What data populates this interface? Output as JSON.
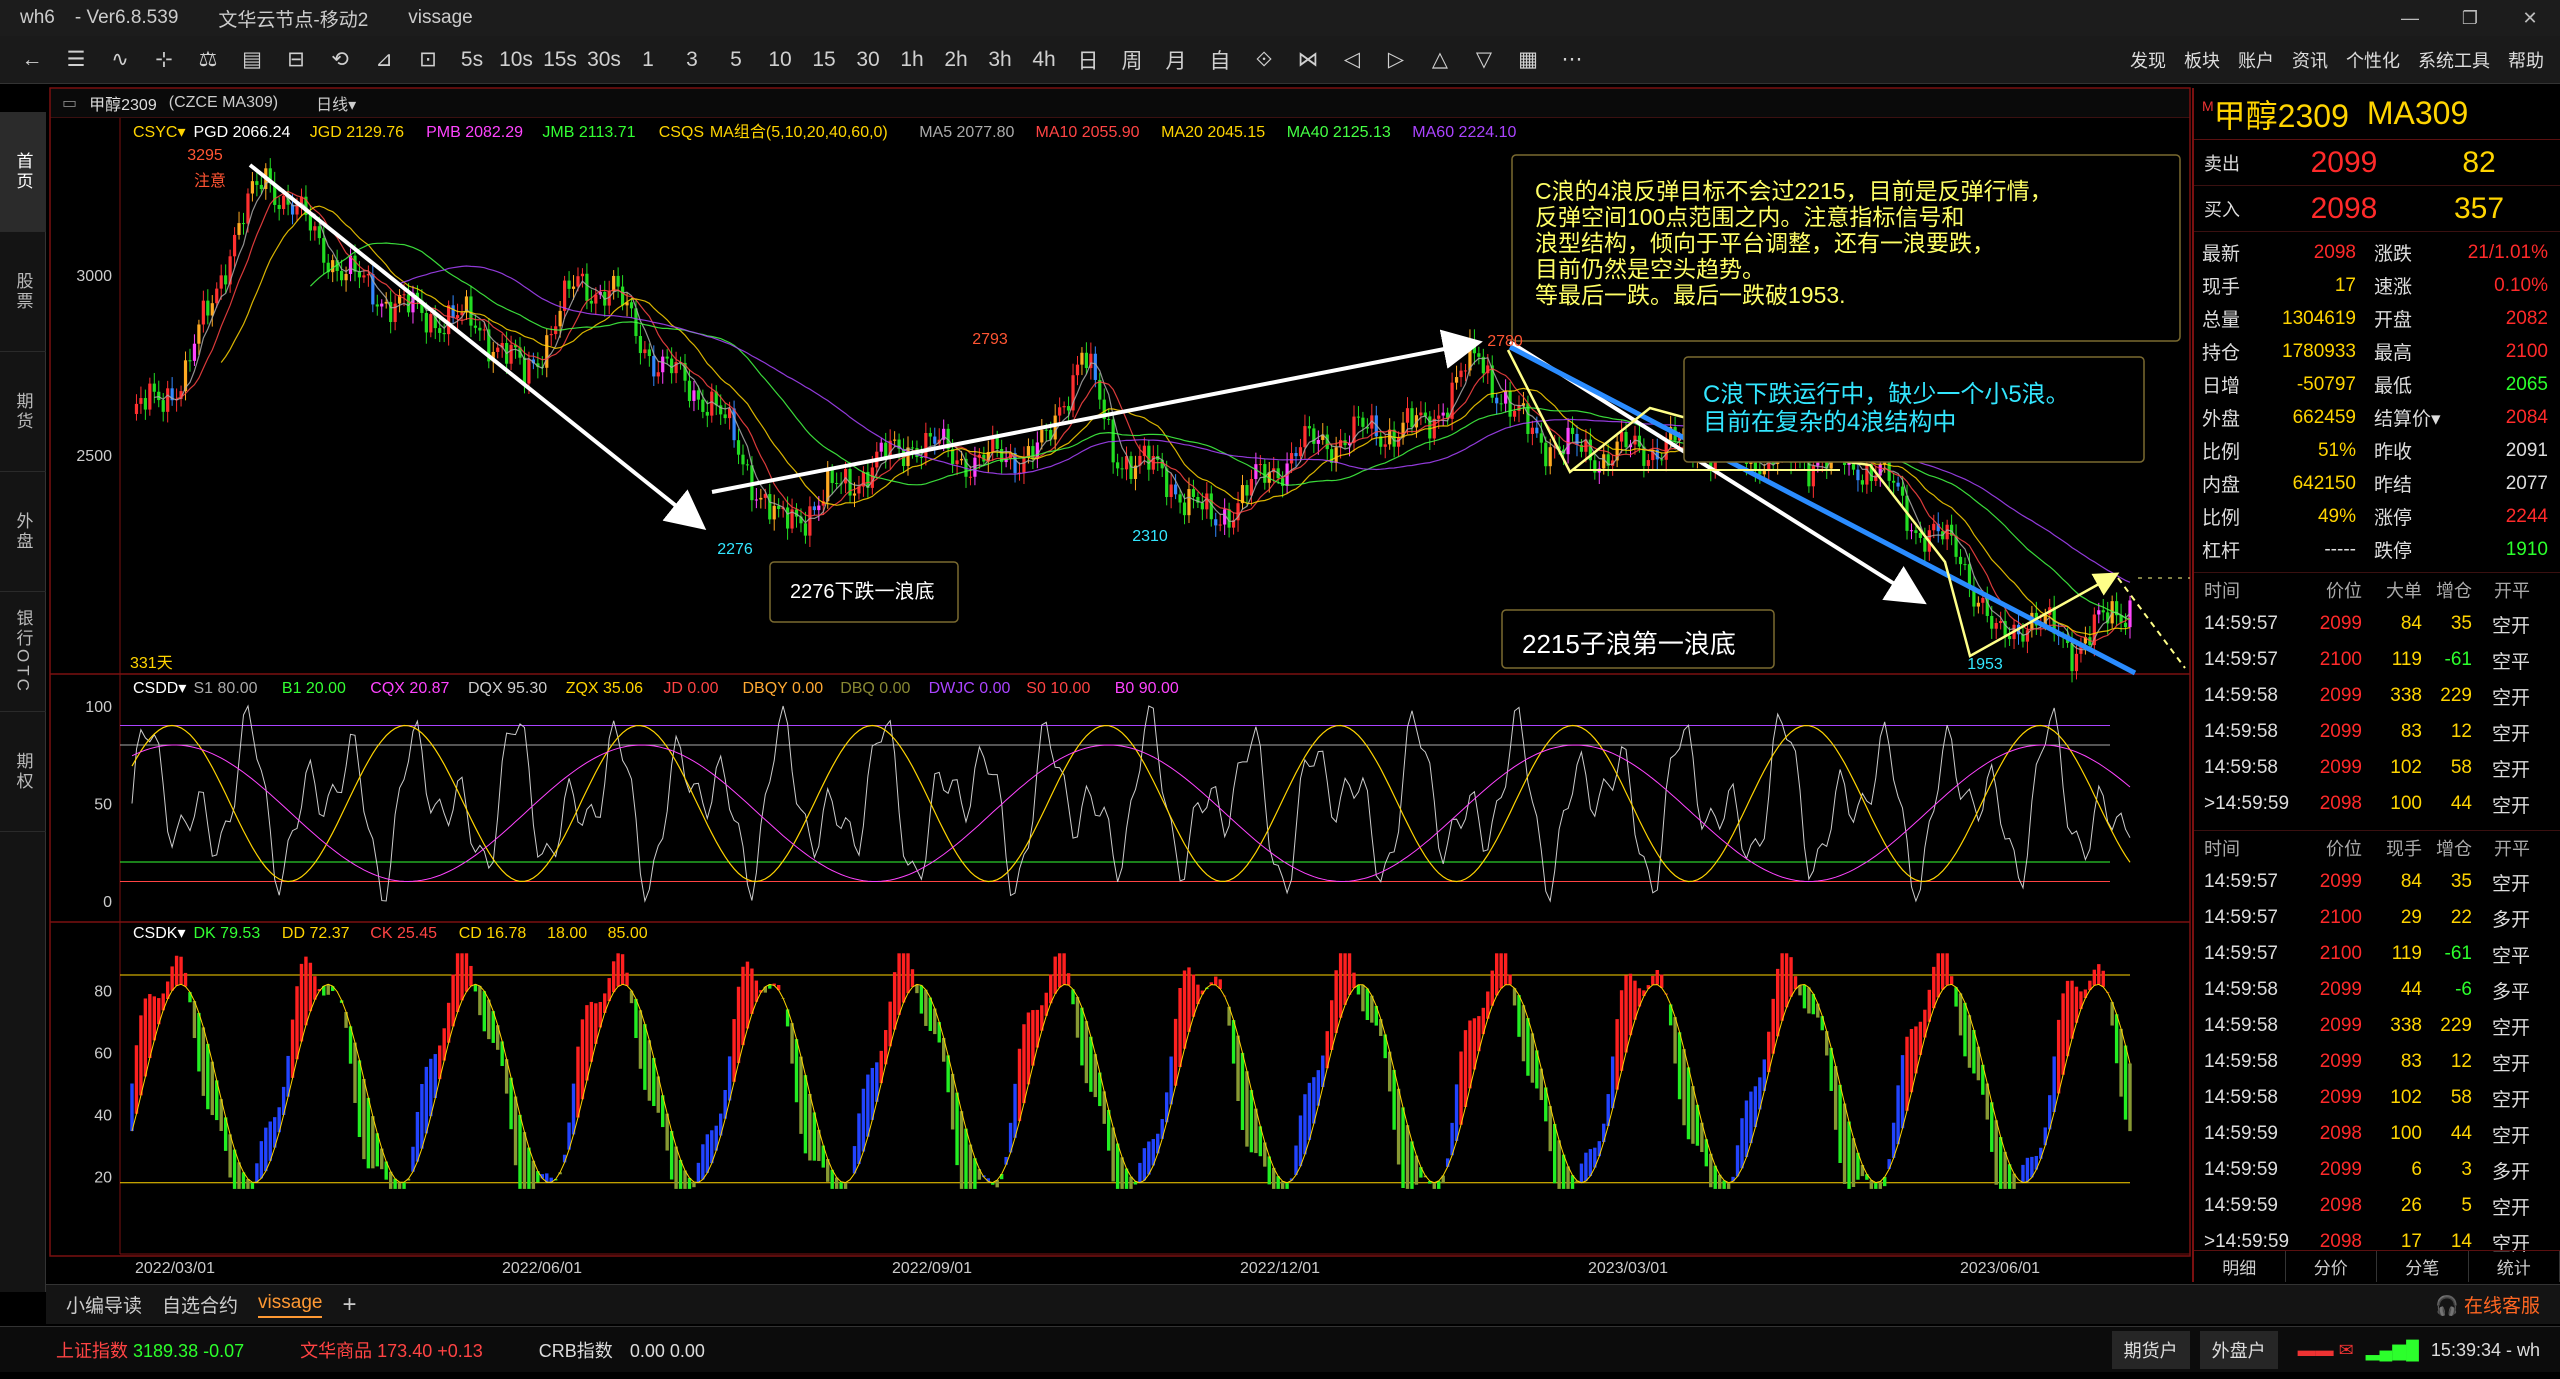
{
  "window": {
    "app": "wh6",
    "version": "Ver6.8.539",
    "server": "文华云节点-移动2",
    "user": "vissage",
    "controls": [
      "—",
      "❐",
      "✕"
    ]
  },
  "toolbar": {
    "tools": [
      "←",
      "☰",
      "∿",
      "⊹",
      "⚖",
      "▤",
      "⊟",
      "⟲",
      "⊿",
      "⊡",
      "5s",
      "10s",
      "15s",
      "30s",
      "1",
      "3",
      "5",
      "10",
      "15",
      "30",
      "1h",
      "2h",
      "3h",
      "4h",
      "日",
      "周",
      "月",
      "自",
      "⟐",
      "⋈",
      "◁",
      "▷",
      "△",
      "▽",
      "▦",
      "⋯"
    ],
    "menu": [
      "发现",
      "板块",
      "账户",
      "资讯",
      "个性化",
      "系统工具",
      "帮助"
    ]
  },
  "sidebar": [
    "首页",
    "股票",
    "期货",
    "外盘",
    "银行OTC",
    "期权"
  ],
  "chart_header": {
    "symbol": "甲醇2309",
    "code": "(CZCE MA309)",
    "period": "日线"
  },
  "main_legend": [
    {
      "t": "CSYC▾",
      "c": "#ffd400"
    },
    {
      "t": "PGD 2066.24",
      "c": "#ffffff"
    },
    {
      "t": "JGD 2129.76",
      "c": "#ffd400"
    },
    {
      "t": "PMB 2082.29",
      "c": "#ff44ff"
    },
    {
      "t": "JMB 2113.71",
      "c": "#33ff33"
    },
    {
      "t": "CSQS",
      "c": "#ffd400"
    },
    {
      "t": "MA组合(5,10,20,40,60,0)",
      "c": "#ffd400"
    },
    {
      "t": "MA5 2077.80",
      "c": "#aaaaaa"
    },
    {
      "t": "MA10 2055.90",
      "c": "#ff4444"
    },
    {
      "t": "MA20 2045.15",
      "c": "#ffd400"
    },
    {
      "t": "MA40 2125.13",
      "c": "#44ff44"
    },
    {
      "t": "MA60 2224.10",
      "c": "#aa44ff"
    }
  ],
  "sub1_legend": [
    {
      "t": "CSDD▾",
      "c": "#ffffff"
    },
    {
      "t": "S1 80.00",
      "c": "#aaaaaa"
    },
    {
      "t": "B1 20.00",
      "c": "#33ff33"
    },
    {
      "t": "CQX 20.87",
      "c": "#ff44ff"
    },
    {
      "t": "DQX 95.30",
      "c": "#cccccc"
    },
    {
      "t": "ZQX 35.06",
      "c": "#ffd400"
    },
    {
      "t": "JD 0.00",
      "c": "#ff4444"
    },
    {
      "t": "DBQY 0.00",
      "c": "#ffaa33"
    },
    {
      "t": "DBQ 0.00",
      "c": "#888833"
    },
    {
      "t": "DWJC 0.00",
      "c": "#aa44ff"
    },
    {
      "t": "S0 10.00",
      "c": "#ff4444"
    },
    {
      "t": "B0 90.00",
      "c": "#ff44ff"
    }
  ],
  "sub2_legend": [
    {
      "t": "CSDK▾",
      "c": "#ffffff"
    },
    {
      "t": "DK 79.53",
      "c": "#33ff33"
    },
    {
      "t": "DD 72.37",
      "c": "#ffd400"
    },
    {
      "t": "CK 25.45",
      "c": "#ff4444"
    },
    {
      "t": "CD 16.78",
      "c": "#ffd400"
    },
    {
      "t": "18.00",
      "c": "#ffd400"
    },
    {
      "t": "85.00",
      "c": "#ffd400"
    }
  ],
  "main_axis": [
    "3000",
    "2500"
  ],
  "sub1_axis": [
    "100",
    "50",
    "0"
  ],
  "sub2_axis": [
    "80",
    "60",
    "40",
    "20"
  ],
  "x_dates": [
    "2022/03/01",
    "2022/06/01",
    "2022/09/01",
    "2022/12/01",
    "2023/03/01",
    "2023/06/01"
  ],
  "price_labels": [
    "3295",
    "注意",
    "2793",
    "2780",
    "2276",
    "2310",
    "1953"
  ],
  "days_label": "331天",
  "annotations": {
    "box1": [
      "C浪的4浪反弹目标不会过2215，目前是反弹行情，",
      "反弹空间100点范围之内。注意指标信号和",
      "浪型结构，倾向于平台调整，还有一浪要跌，",
      "目前仍然是空头趋势。",
      "等最后一跌。最后一跌破1953."
    ],
    "box2": [
      "C浪下跌运行中，缺少一个小5浪。",
      "目前在复杂的4浪结构中"
    ],
    "box3": "2276下跌一浪底",
    "box4": "2215子浪第一浪底"
  },
  "quote": {
    "symbol": "甲醇2309",
    "code": "MA309",
    "flag": "M",
    "ask": {
      "label": "卖出",
      "price": "2099",
      "vol": "82"
    },
    "bid": {
      "label": "买入",
      "price": "2098",
      "vol": "357"
    },
    "stats": [
      [
        "最新",
        "2098",
        "pos",
        "涨跌",
        "21/1.01%",
        "pos"
      ],
      [
        "现手",
        "17",
        "yel",
        "速涨",
        "0.10%",
        "pos"
      ],
      [
        "总量",
        "1304619",
        "yel",
        "开盘",
        "2082",
        "pos"
      ],
      [
        "持仓",
        "1780933",
        "yel",
        "最高",
        "2100",
        "pos"
      ],
      [
        "日增",
        "-50797",
        "yel",
        "最低",
        "2065",
        "neg"
      ],
      [
        "外盘",
        "662459",
        "yel",
        "结算价▾",
        "2084",
        "pos"
      ],
      [
        "比例",
        "51%",
        "yel",
        "昨收",
        "2091",
        ""
      ],
      [
        "内盘",
        "642150",
        "yel",
        "昨结",
        "2077",
        ""
      ],
      [
        "比例",
        "49%",
        "yel",
        "涨停",
        "2244",
        "pos"
      ],
      [
        "杠杆",
        "-----",
        "",
        "跌停",
        "1910",
        "neg"
      ]
    ]
  },
  "ticks1": {
    "head": [
      "时间",
      "价位",
      "大单",
      "增仓",
      "开平"
    ],
    "rows": [
      [
        "14:59:57",
        "2099",
        "84",
        "35",
        "空开"
      ],
      [
        "14:59:57",
        "2100",
        "119",
        "-61",
        "空平"
      ],
      [
        "14:59:58",
        "2099",
        "338",
        "229",
        "空开"
      ],
      [
        "14:59:58",
        "2099",
        "83",
        "12",
        "空开"
      ],
      [
        "14:59:58",
        "2099",
        "102",
        "58",
        "空开"
      ],
      [
        ">14:59:59",
        "2098",
        "100",
        "44",
        "空开"
      ]
    ]
  },
  "ticks2": {
    "head": [
      "时间",
      "价位",
      "现手",
      "增仓",
      "开平"
    ],
    "rows": [
      [
        "14:59:57",
        "2099",
        "84",
        "35",
        "空开"
      ],
      [
        "14:59:57",
        "2100",
        "29",
        "22",
        "多开"
      ],
      [
        "14:59:57",
        "2100",
        "119",
        "-61",
        "空平"
      ],
      [
        "14:59:58",
        "2099",
        "44",
        "-6",
        "多平"
      ],
      [
        "14:59:58",
        "2099",
        "338",
        "229",
        "空开"
      ],
      [
        "14:59:58",
        "2099",
        "83",
        "12",
        "空开"
      ],
      [
        "14:59:58",
        "2099",
        "102",
        "58",
        "空开"
      ],
      [
        "14:59:59",
        "2098",
        "100",
        "44",
        "空开"
      ],
      [
        "14:59:59",
        "2099",
        "6",
        "3",
        "多开"
      ],
      [
        "14:59:59",
        "2098",
        "26",
        "5",
        "空开"
      ],
      [
        ">14:59:59",
        "2098",
        "17",
        "14",
        "空开"
      ]
    ]
  },
  "rp_tabs": [
    "明细",
    "分价",
    "分笔",
    "统计"
  ],
  "bottom_tabs": [
    "小编导读",
    "自选合约",
    "vissage",
    "+"
  ],
  "service": "在线客服",
  "status": {
    "idx1_name": "上证指数",
    "idx1_val": "3189.38",
    "idx1_chg": "-0.07",
    "idx2_name": "文华商品",
    "idx2_val": "173.40",
    "idx2_chg": "+0.13",
    "idx3_name": "CRB指数",
    "idx3_val": "0.00",
    "idx3_chg": "0.00",
    "btn1": "期货户",
    "btn2": "外盘户",
    "time": "15:39:34 - wh"
  }
}
